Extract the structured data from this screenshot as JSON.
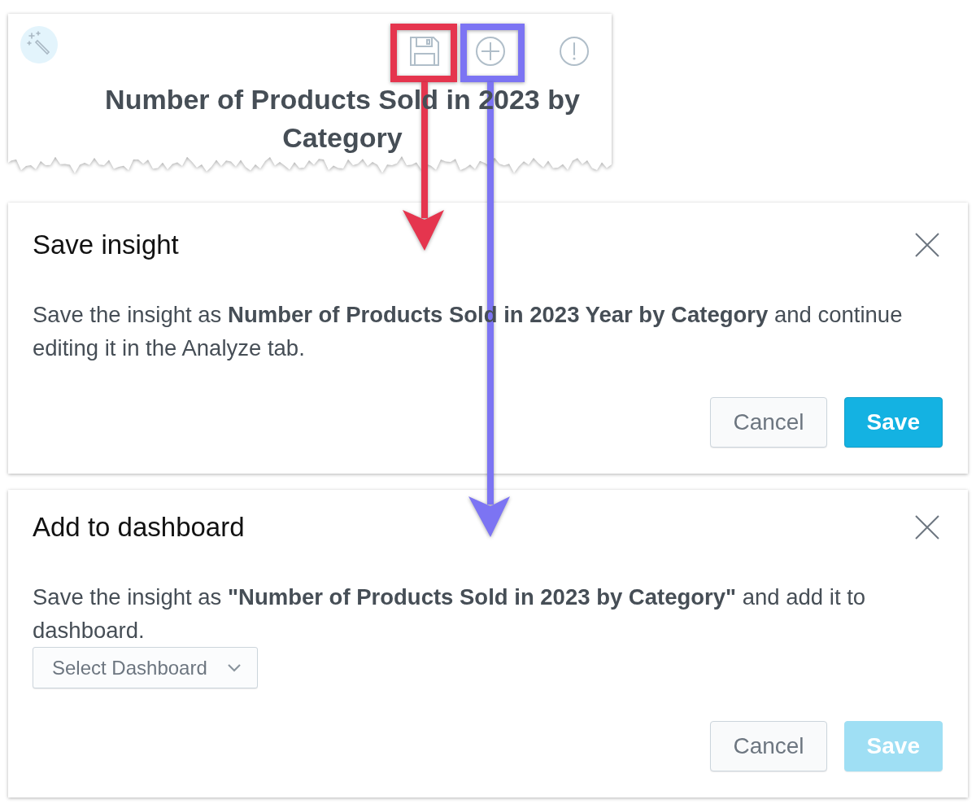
{
  "insight_card": {
    "title": "Number of Products Sold in 2023 by Category"
  },
  "callouts": [
    {
      "color": "#e5354e"
    },
    {
      "color": "#7c74f3"
    }
  ],
  "dialogs": [
    {
      "title": "Save insight",
      "message": "Save the insight as **Number of Products Sold in 2023 Year by Category** and continue editing it in the Analyze tab.",
      "buttons": [
        {
          "label": "Cancel",
          "kind": "secondary",
          "disabled": false
        },
        {
          "label": "Save",
          "kind": "primary",
          "disabled": false
        }
      ]
    },
    {
      "title": "Add to dashboard",
      "message": "Save the insight as **\"Number of Products Sold in 2023 by Category\"** and add it to dashboard.",
      "dropdown": {
        "label": "Select Dashboard"
      },
      "buttons": [
        {
          "label": "Cancel",
          "kind": "secondary",
          "disabled": false
        },
        {
          "label": "Save",
          "kind": "primary",
          "disabled": true
        }
      ]
    }
  ]
}
